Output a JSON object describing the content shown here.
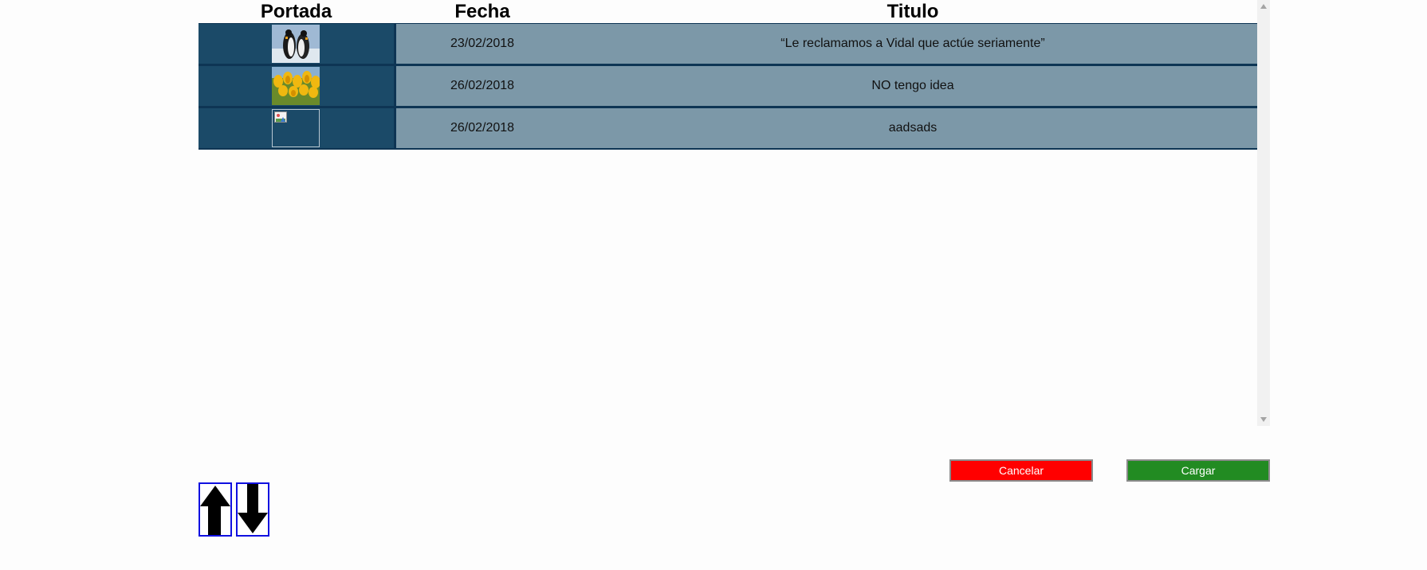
{
  "table": {
    "headers": {
      "cover": "Portada",
      "date": "Fecha",
      "title": "Titulo"
    },
    "rows": [
      {
        "cover_icon": "penguins-thumbnail",
        "date": "23/02/2018",
        "title": "“Le reclamamos a Vidal que actúe seriamente”"
      },
      {
        "cover_icon": "tulips-thumbnail",
        "date": "26/02/2018",
        "title": "NO tengo idea"
      },
      {
        "cover_icon": "broken-image-thumbnail",
        "date": "26/02/2018",
        "title": "aadsads"
      }
    ]
  },
  "actions": {
    "cancel_label": "Cancelar",
    "load_label": "Cargar"
  },
  "reorder": {
    "up_icon": "arrow-up-icon",
    "down_icon": "arrow-down-icon"
  },
  "colors": {
    "cover_cell": "#1b4a68",
    "info_cell": "#7c98a8",
    "row_border": "#0e3554",
    "cancel": "#ff0000",
    "load": "#228b22",
    "arrow_border": "#1010e0"
  }
}
